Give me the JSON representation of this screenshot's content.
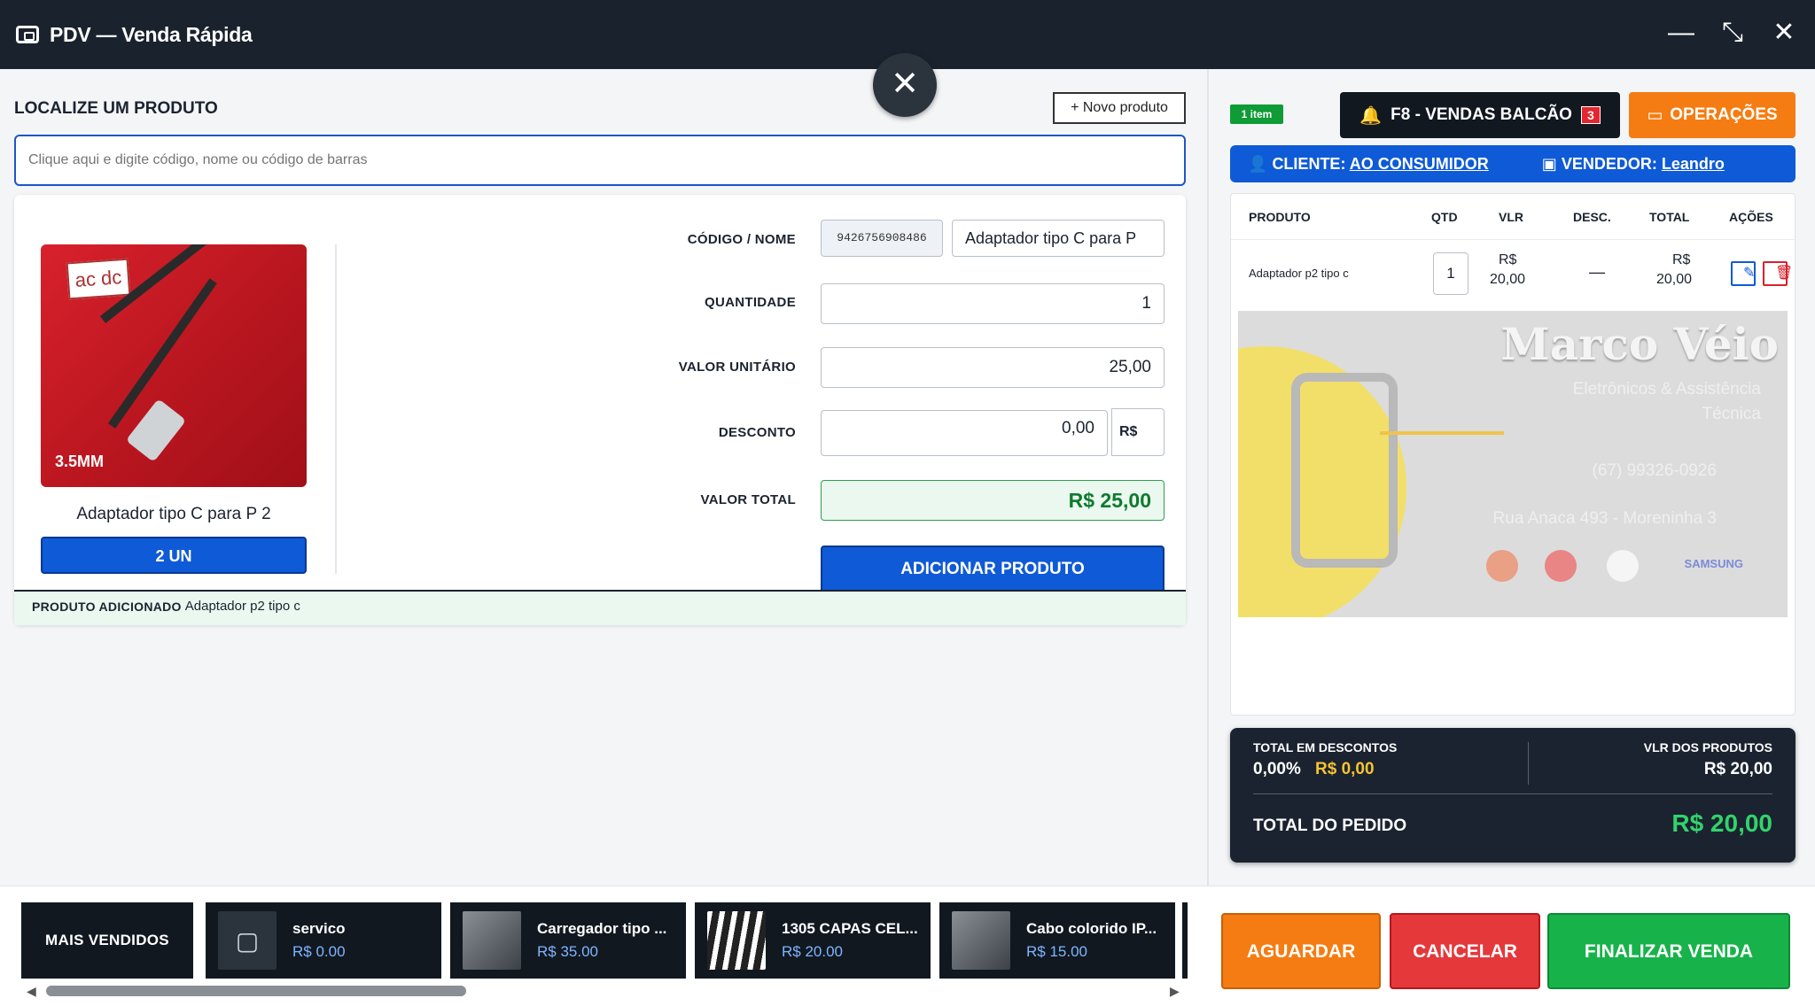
{
  "window": {
    "title": "PDV — Venda Rápida",
    "controls": [
      "minimize-icon",
      "collapse-icon",
      "close-icon"
    ]
  },
  "left": {
    "section_title": "LOCALIZE UM PRODUTO",
    "new_product_label": "+ Novo produto",
    "search_placeholder": "Clique aqui e digite código, nome ou código de barras",
    "product": {
      "image_label": "ac dc",
      "image_caption": "3.5MM",
      "name": "Adaptador tipo C para P 2",
      "units": "2 UN"
    },
    "fields": {
      "codigo_label": "CÓDIGO / NOME",
      "codigo_value": "9426756908486",
      "nome_value": "Adaptador tipo C para P",
      "quantidade_label": "QUANTIDADE",
      "quantidade_value": "1",
      "valor_unitario_label": "VALOR UNITÁRIO",
      "valor_unitario_value": "25,00",
      "desconto_label": "DESCONTO",
      "desconto_value": "0,00",
      "desconto_unit": "R$",
      "valor_total_label": "VALOR TOTAL",
      "valor_total_value": "R$ 25,00"
    },
    "add_button": "ADICIONAR PRODUTO",
    "added_label": "PRODUTO ADICIONADO",
    "added_value": "Adaptador p2 tipo c"
  },
  "right": {
    "item_badge": "1 item",
    "f8_label": "F8 -  VENDAS BALCÃO",
    "f8_count": "3",
    "operacoes_label": "OPERAÇÕES",
    "cliente_label": "CLIENTE:",
    "cliente_value": "AO CONSUMIDOR",
    "vendedor_label": "VENDEDOR:",
    "vendedor_value": "Leandro",
    "cart_headers": {
      "produto": "PRODUTO",
      "qtd": "QTD",
      "vlr": "VLR",
      "desc": "DESC.",
      "total": "TOTAL",
      "acoes": "AÇÕES"
    },
    "cart_items": [
      {
        "produto": "Adaptador p2 tipo c",
        "qtd": "1",
        "vlr_currency": "R$",
        "vlr": "20,00",
        "desc": "—",
        "total_currency": "R$",
        "total": "20,00"
      }
    ],
    "store_logo": {
      "brand": "Marco Véio",
      "line1": "Eletrônicos & Assistência",
      "line2": "Técnica",
      "phone": "(67) 99326-0926",
      "address": "Rua Anaca 493 - Moreninha 3",
      "samsung": "SAMSUNG"
    },
    "summary": {
      "descontos_label": "TOTAL EM DESCONTOS",
      "descontos_pct": "0,00%",
      "descontos_value": "R$ 0,00",
      "produtos_label": "VLR DOS PRODUTOS",
      "produtos_value": "R$ 20,00",
      "pedido_label": "TOTAL DO PEDIDO",
      "pedido_value": "R$ 20,00"
    }
  },
  "bottom": {
    "mais_vendidos": "MAIS VENDIDOS",
    "products": [
      {
        "name": "servico",
        "price": "R$ 0.00"
      },
      {
        "name": "Carregador tipo ...",
        "price": "R$ 35.00"
      },
      {
        "name": "1305 CAPAS CEL...",
        "price": "R$ 20.00"
      },
      {
        "name": "Cabo colorido IP...",
        "price": "R$ 15.00"
      }
    ],
    "aguardar": "AGUARDAR",
    "cancelar": "CANCELAR",
    "finalizar": "FINALIZAR VENDA"
  },
  "colors": {
    "titlebar": "#1a222d",
    "primary_blue": "#0f5ad6",
    "orange": "#f57c12",
    "red": "#e5383b",
    "green": "#17b34a",
    "dark": "#111820"
  }
}
